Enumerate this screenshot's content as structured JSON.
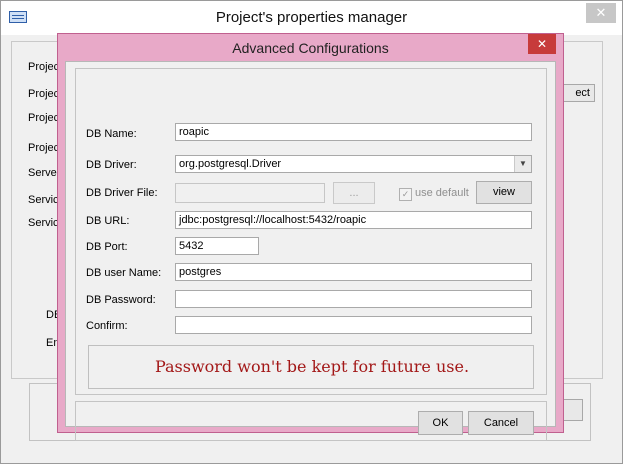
{
  "main_window": {
    "title": "Project's properties manager",
    "close_glyph": "✕",
    "app_icon": "application-icon",
    "labels": [
      "Projec",
      "Projec",
      "Projec",
      "Projec",
      "Serve",
      "Servic",
      "Servic",
      "DB",
      "En"
    ],
    "right_button_label": "ect"
  },
  "dialog": {
    "title": "Advanced Configurations",
    "close_glyph": "✕",
    "fields": {
      "db_name": {
        "label": "DB Name:",
        "value": "roapic"
      },
      "db_driver": {
        "label": "DB Driver:",
        "value": "org.postgresql.Driver"
      },
      "db_driver_file": {
        "label": "DB Driver File:",
        "value": "",
        "browse_label": "...",
        "use_default_label": "use default",
        "use_default_checked": true,
        "view_label": "view"
      },
      "db_url": {
        "label": "DB URL:",
        "value": "jdbc:postgresql://localhost:5432/roapic"
      },
      "db_port": {
        "label": "DB Port:",
        "value": "5432"
      },
      "db_user": {
        "label": "DB user Name:",
        "value": "postgres"
      },
      "db_password": {
        "label": "DB Password:",
        "value": ""
      },
      "confirm": {
        "label": "Confirm:",
        "value": ""
      }
    },
    "message": "Password won't be kept for future use.",
    "ok_label": "OK",
    "cancel_label": "Cancel"
  },
  "colors": {
    "dialog_border": "#e8a9c8",
    "close_red": "#c73b3b",
    "message_red": "#a31818"
  }
}
